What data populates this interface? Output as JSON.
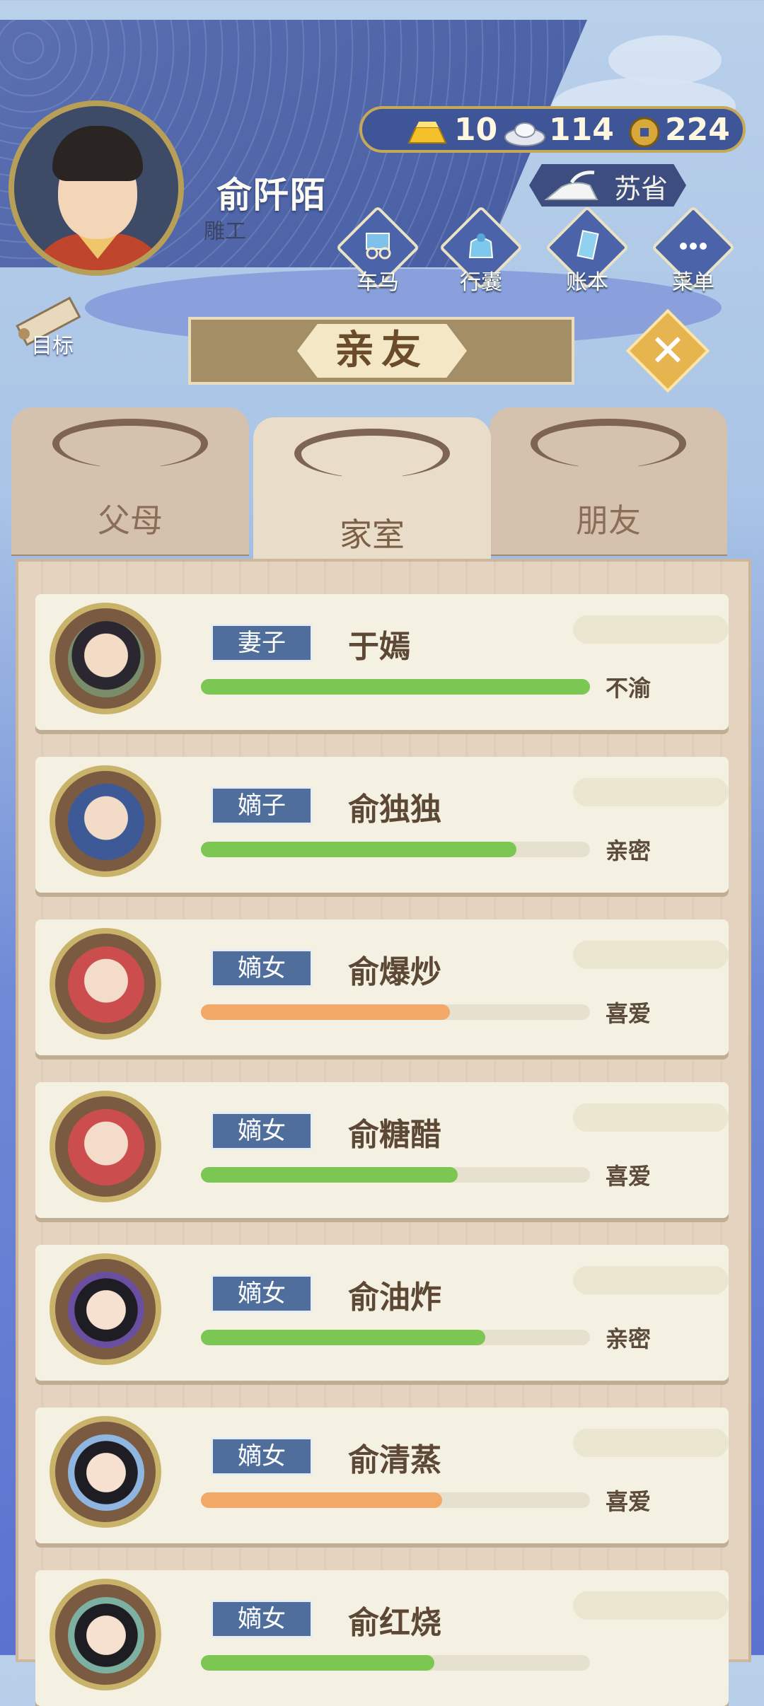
{
  "player": {
    "name": "俞阡陌",
    "title": "雕工"
  },
  "currency": {
    "gold": "10",
    "silver": "114",
    "copper": "224"
  },
  "province": "苏省",
  "menu": [
    {
      "label": "车马",
      "icon": "carriage-icon"
    },
    {
      "label": "行囊",
      "icon": "bag-icon"
    },
    {
      "label": "账本",
      "icon": "ledger-icon"
    },
    {
      "label": "菜单",
      "icon": "more-icon"
    }
  ],
  "goal_label": "目标",
  "title": "亲友",
  "tabs": [
    {
      "label": "父母",
      "active": false
    },
    {
      "label": "家室",
      "active": true
    },
    {
      "label": "朋友",
      "active": false
    }
  ],
  "colors": {
    "green_bar": "#7cc653",
    "orange_bar": "#f2a866",
    "role_bg": "#4f6e9c"
  },
  "members": [
    {
      "role": "妻子",
      "name": "于嫣",
      "status": "不渝",
      "affection": 1.0,
      "bar": "green",
      "avatar": "wife-portrait"
    },
    {
      "role": "嫡子",
      "name": "俞独独",
      "status": "亲密",
      "affection": 0.81,
      "bar": "green",
      "avatar": "son-portrait"
    },
    {
      "role": "嫡女",
      "name": "俞爆炒",
      "status": "喜爱",
      "affection": 0.64,
      "bar": "orange",
      "avatar": "daughter-portrait"
    },
    {
      "role": "嫡女",
      "name": "俞糖醋",
      "status": "喜爱",
      "affection": 0.66,
      "bar": "green",
      "avatar": "daughter-portrait"
    },
    {
      "role": "嫡女",
      "name": "俞油炸",
      "status": "亲密",
      "affection": 0.73,
      "bar": "green",
      "avatar": "daughter-portrait"
    },
    {
      "role": "嫡女",
      "name": "俞清蒸",
      "status": "喜爱",
      "affection": 0.62,
      "bar": "orange",
      "avatar": "daughter-portrait"
    },
    {
      "role": "嫡女",
      "name": "俞红烧",
      "status": "",
      "affection": 0.6,
      "bar": "green",
      "avatar": "daughter-portrait"
    }
  ]
}
